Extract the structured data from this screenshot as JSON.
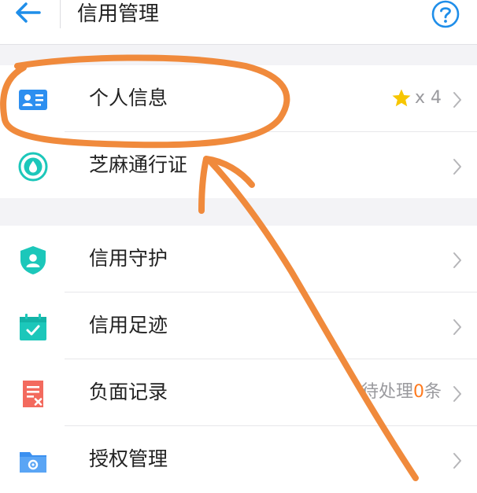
{
  "header": {
    "title": "信用管理",
    "back_icon": "arrow-left-icon",
    "help_icon": "question-circle-icon"
  },
  "colors": {
    "accent_blue": "#1f8ee9",
    "teal": "#1cc7ba",
    "red": "#f36a5e",
    "star_gold": "#f7c600",
    "highlight_count": "#ff7a1e",
    "annotation": "#f08a3c"
  },
  "groups": [
    {
      "items": [
        {
          "label": "个人信息",
          "icon": "id-card-icon",
          "stars_prefix": "x",
          "stars_count": "4"
        },
        {
          "label": "芝麻通行证",
          "icon": "sesame-pass-icon"
        }
      ]
    },
    {
      "items": [
        {
          "label": "信用守护",
          "icon": "shield-user-icon"
        },
        {
          "label": "信用足迹",
          "icon": "calendar-check-icon"
        },
        {
          "label": "负面记录",
          "icon": "document-x-icon",
          "pending_prefix": "待处理",
          "pending_count": "0",
          "pending_suffix": "条"
        },
        {
          "label": "授权管理",
          "icon": "folder-settings-icon"
        }
      ]
    }
  ]
}
